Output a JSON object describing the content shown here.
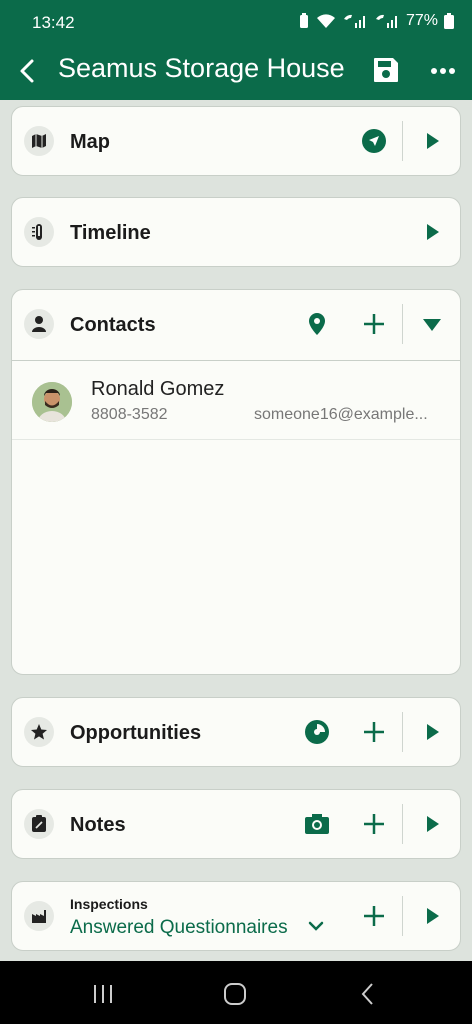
{
  "status_bar": {
    "time": "13:42",
    "battery": "77%"
  },
  "app_bar": {
    "title": "Seamus Storage House"
  },
  "sections": {
    "map": {
      "title": "Map"
    },
    "timeline": {
      "title": "Timeline"
    },
    "contacts": {
      "title": "Contacts",
      "items": [
        {
          "name": "Ronald Gomez",
          "phone": "8808-3582",
          "email": "someone16@example..."
        }
      ]
    },
    "opportunities": {
      "title": "Opportunities"
    },
    "notes": {
      "title": "Notes"
    },
    "inspections": {
      "label": "Inspections",
      "value": "Answered Questionnaires"
    }
  },
  "colors": {
    "brand": "#0b6b4a",
    "background": "#dde3dd",
    "card": "#fbfcf8"
  },
  "icons": {
    "map": "map-icon",
    "timeline": "timeline-icon",
    "contacts": "person-icon",
    "opportunities": "star-icon",
    "notes": "note-icon",
    "inspections": "factory-icon"
  }
}
